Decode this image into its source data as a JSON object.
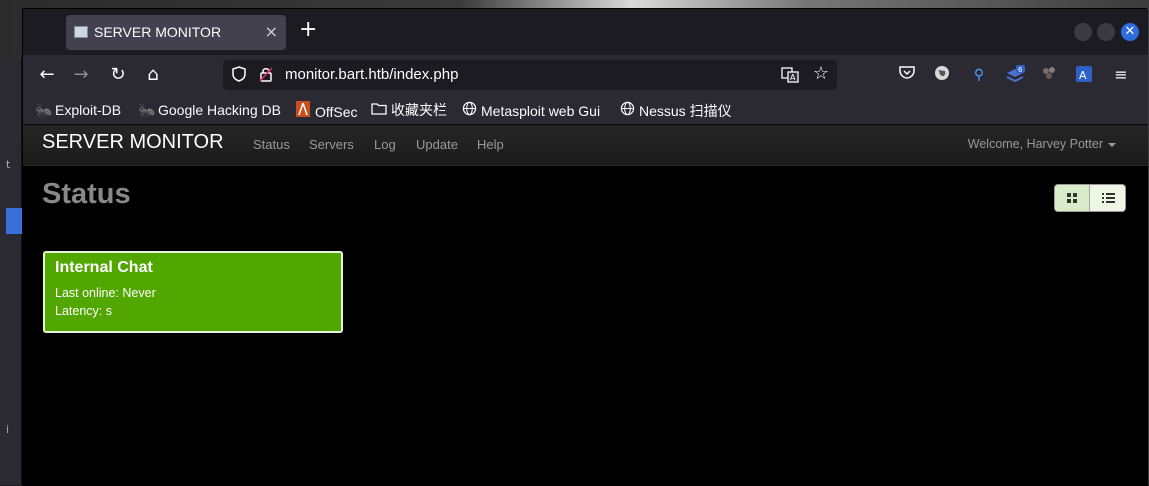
{
  "browser": {
    "tab_title": "SERVER MONITOR",
    "tab_close": "×",
    "new_tab": "+",
    "url": "monitor.bart.htb/index.php",
    "extension_badge": "6"
  },
  "bookmarks": [
    {
      "label": "Exploit-DB",
      "icon": "exploit-db-icon"
    },
    {
      "label": "Google Hacking DB",
      "icon": "ghdb-icon"
    },
    {
      "label": "OffSec",
      "icon": "offsec-icon"
    },
    {
      "label": "收藏夹栏",
      "icon": "folder-icon"
    },
    {
      "label": "Metasploit web Gui",
      "icon": "globe-icon"
    },
    {
      "label": "Nessus 扫描仪",
      "icon": "globe-icon"
    }
  ],
  "app": {
    "brand": "SERVER MONITOR",
    "menu": [
      "Status",
      "Servers",
      "Log",
      "Update",
      "Help"
    ],
    "welcome": "Welcome, Harvey Potter"
  },
  "main": {
    "heading": "Status",
    "cards": [
      {
        "title": "Internal Chat",
        "last_online": "Last online: Never",
        "latency": "Latency: s",
        "status_color": "#51a600"
      }
    ]
  },
  "colors": {
    "accent_green": "#51a600",
    "page_bg": "#000000",
    "browser_bg": "#2b2a33"
  }
}
